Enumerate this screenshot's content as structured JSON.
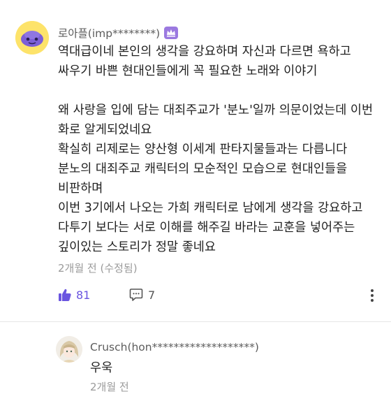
{
  "comment": {
    "author": "로아플(imp********)",
    "lines": [
      "역대급이네  본인의 생각을 강요하며 자신과 다르면 욕하고",
      "싸우기 바쁜 현대인들에게 꼭 필요한 노래와 이야기",
      "",
      "왜 사랑을 입에 담는 대죄주교가 '분노'일까 의문이었는데 이번",
      "화로 알게되었네요",
      "확실히 리제로는 양산형 이세계 판타지물들과는 다릅니다",
      "분노의 대죄주교 캐릭터의 모순적인 모습으로 현대인들을",
      "비판하며",
      "이번 3기에서 나오는 가희 캐릭터로  남에게 생각을 강요하고",
      "다투기 보다는 서로 이해를 해주길 바라는 교훈을 넣어주는",
      "깊이있는 스토리가 정말 좋네요"
    ],
    "meta": "2개월 전 (수정됨)",
    "likes": "81",
    "replies": "7"
  },
  "reply": {
    "author": "Crusch(hon*******************)",
    "text": "우욱",
    "meta": "2개월 전"
  },
  "colors": {
    "accent": "#6a55e0",
    "muted": "#9a9a9a",
    "badge": "#9b79e0"
  }
}
